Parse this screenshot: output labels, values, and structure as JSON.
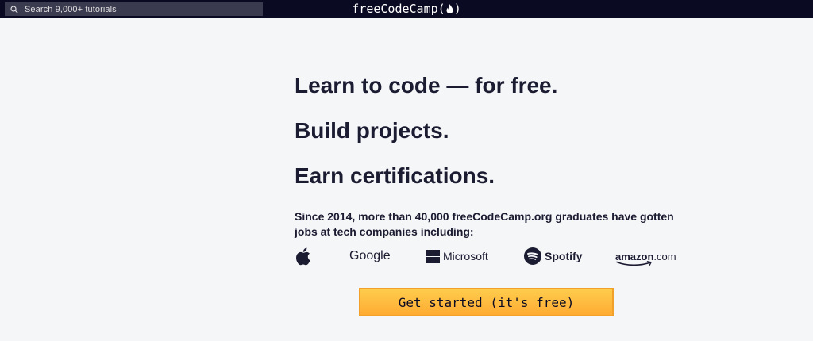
{
  "navbar": {
    "search": {
      "placeholder": "Search 9,000+ tutorials",
      "icon": "search-icon"
    },
    "brand": {
      "text": "freeCodeCamp",
      "open_paren": "(",
      "close_paren": ")",
      "icon": "flame-icon"
    }
  },
  "hero": {
    "headline_1": "Learn to code — for free.",
    "headline_2": "Build projects.",
    "headline_3": "Earn certifications.",
    "subtext": "Since 2014, more than 40,000 freeCodeCamp.org graduates have gotten jobs at tech companies including:",
    "logos": [
      {
        "name": "Apple",
        "icon": "apple-icon"
      },
      {
        "name": "Google"
      },
      {
        "name": "Microsoft",
        "icon": "microsoft-icon"
      },
      {
        "name": "Spotify",
        "icon": "spotify-icon"
      },
      {
        "name": "amazon",
        "suffix": ".com"
      }
    ],
    "cta_label": "Get started (it's free)"
  },
  "colors": {
    "navbar_bg": "#0a0a23",
    "page_bg": "#f5f6f7",
    "text": "#1b1b32",
    "cta_bg": "#fecc4c",
    "cta_border": "#f1a02a"
  }
}
